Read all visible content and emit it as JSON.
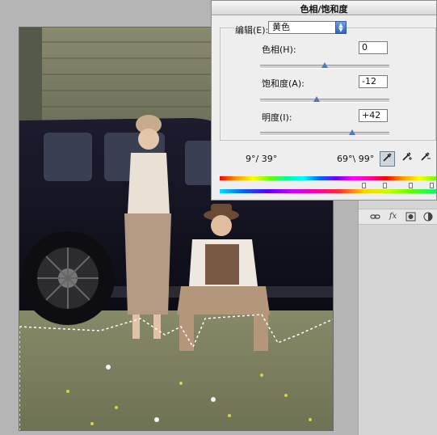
{
  "dialog": {
    "title": "色相/饱和度",
    "edit_label": "编辑(E):",
    "edit_value": "黄色",
    "hue": {
      "label": "色相(H):",
      "value": "0",
      "level": 0.5
    },
    "saturation": {
      "label": "饱和度(A):",
      "value": "-12",
      "level": 0.44
    },
    "lightness": {
      "label": "明度(I):",
      "value": "+42",
      "level": 0.71
    },
    "range_left": "9°/ 39°",
    "range_right": "69°\\ 99°",
    "tools": [
      "eyedropper-icon",
      "eyedropper-plus-icon",
      "eyedropper-minus-icon"
    ]
  },
  "layers_panel": {
    "icons": [
      "link-icon",
      "fx-icon",
      "mask-icon",
      "adjustment-icon"
    ],
    "fx_label": "fx"
  },
  "colors": {
    "dialog_bg": "#eeeeee",
    "slider_thumb": "#4d78c8",
    "select_arrow": "#2f62c8",
    "canvas_bg": "#b5b5b5"
  }
}
